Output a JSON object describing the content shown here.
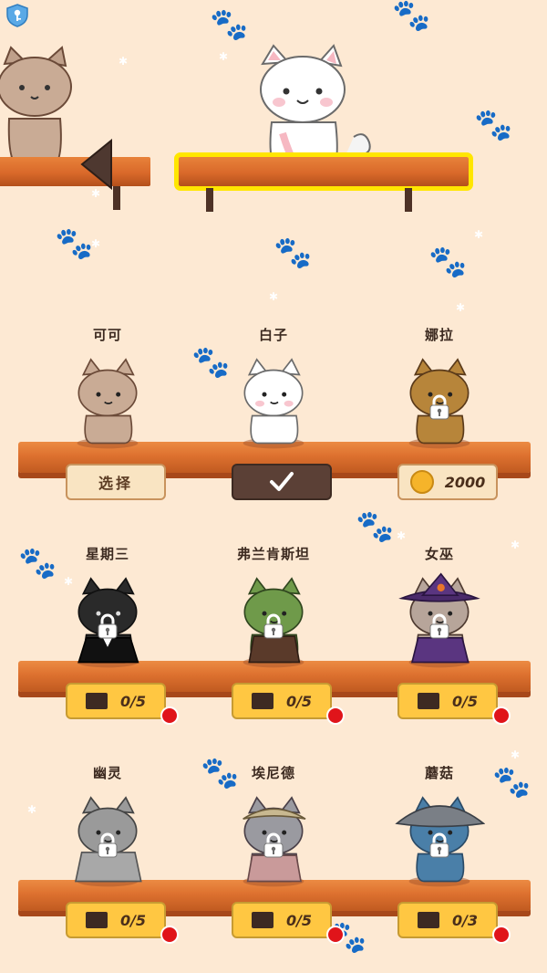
{
  "colors": {
    "background": "#fde9d3",
    "shelf": "#dd712f",
    "highlight": "#ffe600",
    "video_badge": "#ffc742",
    "notify_dot": "#e0141a"
  },
  "top_display": {
    "left_cat": "cat-tabby-icon",
    "center_cat": "cat-white-icon",
    "prev_arrow": "triangle-left-icon"
  },
  "rows": [
    [
      {
        "name": "可可",
        "cat": "cat-tabby",
        "status": "select",
        "label": "选择"
      },
      {
        "name": "白子",
        "cat": "cat-white",
        "status": "selected",
        "label": "✔"
      },
      {
        "name": "娜拉",
        "cat": "cat-calico",
        "status": "price",
        "label": "2000"
      }
    ],
    [
      {
        "name": "星期三",
        "cat": "cat-black",
        "status": "video",
        "label": "0/5"
      },
      {
        "name": "弗兰肯斯坦",
        "cat": "cat-green",
        "status": "video",
        "label": "0/5"
      },
      {
        "name": "女巫",
        "cat": "cat-witch",
        "status": "video",
        "label": "0/5"
      }
    ],
    [
      {
        "name": "幽灵",
        "cat": "cat-ghost",
        "status": "video",
        "label": "0/5"
      },
      {
        "name": "埃尼德",
        "cat": "cat-enid",
        "status": "video",
        "label": "0/5"
      },
      {
        "name": "蘑菇",
        "cat": "cat-mushroom",
        "status": "video",
        "label": "0/3"
      }
    ]
  ]
}
